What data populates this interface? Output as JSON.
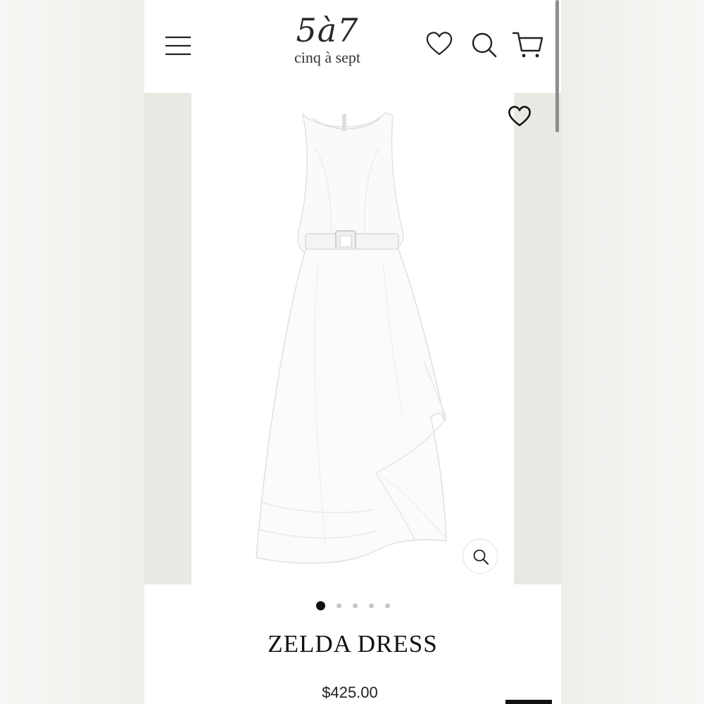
{
  "brand": {
    "logo_mark": "5à7",
    "logo_text": "cinq à sept"
  },
  "header": {
    "icons": [
      "menu-icon",
      "heart-icon",
      "search-icon",
      "cart-icon"
    ]
  },
  "gallery": {
    "image_subject": "white sleeveless belted midi dress",
    "slide_count": 5,
    "active_slide": 1,
    "icons": [
      "heart-icon",
      "zoom-icon"
    ]
  },
  "product": {
    "title": "ZELDA DRESS",
    "price": "$425.00"
  },
  "colors": {
    "text": "#111111",
    "background": "#ffffff",
    "gallery_bg": "#e9e9e4",
    "dot_inactive": "#c8c8c8"
  }
}
